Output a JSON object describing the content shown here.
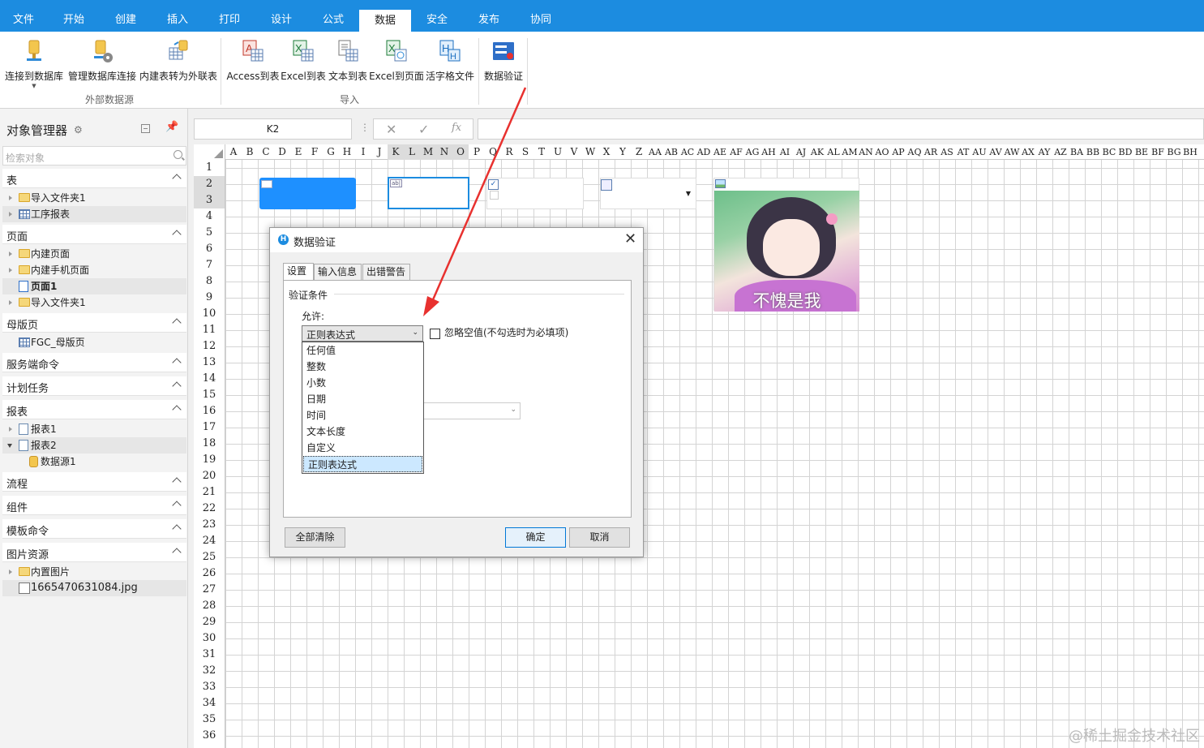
{
  "menu": {
    "tabs": [
      "文件",
      "开始",
      "创建",
      "插入",
      "打印",
      "设计",
      "公式",
      "数据",
      "安全",
      "发布",
      "协同"
    ],
    "active": "数据"
  },
  "ribbon": {
    "buttons": [
      "连接到数据库",
      "管理数据库连接",
      "内建表转为外联表",
      "Access到表",
      "Excel到表",
      "文本到表",
      "Excel到页面",
      "活字格文件",
      "数据验证"
    ],
    "groups": [
      "外部数据源",
      "导入"
    ]
  },
  "side": {
    "title": "对象管理器",
    "search_placeholder": "检索对象",
    "sections": [
      "表",
      "页面",
      "母版页",
      "服务端命令",
      "计划任务",
      "报表",
      "流程",
      "组件",
      "模板命令",
      "图片资源"
    ],
    "items": [
      "导入文件夹1",
      "工序报表",
      "内建页面",
      "内建手机页面",
      "页面1",
      "导入文件夹1",
      "FGC_母版页",
      "报表1",
      "报表2",
      "数据源1",
      "内置图片",
      "1665470631084.jpg"
    ]
  },
  "formula": {
    "cell": "K2",
    "dots": "⋮",
    "cancel": "✕",
    "confirm": "✓",
    "fx": "fx",
    "value": ""
  },
  "sheet": {
    "columns": [
      "A",
      "B",
      "C",
      "D",
      "E",
      "F",
      "G",
      "H",
      "I",
      "J",
      "K",
      "L",
      "M",
      "N",
      "O",
      "P",
      "Q",
      "R",
      "S",
      "T",
      "U",
      "V",
      "W",
      "X",
      "Y",
      "Z",
      "AA",
      "AB",
      "AC",
      "AD",
      "AE",
      "AF",
      "AG",
      "AH",
      "AI",
      "AJ",
      "AK",
      "AL",
      "AM",
      "AN",
      "AO",
      "AP",
      "AQ",
      "AR",
      "AS",
      "AT",
      "AU",
      "AV",
      "AW",
      "AX",
      "AY",
      "AZ",
      "BA",
      "BB",
      "BC",
      "BD",
      "BE",
      "BF",
      "BG",
      "BH"
    ],
    "rows": [
      "1",
      "2",
      "3",
      "4",
      "5",
      "6",
      "7",
      "8",
      "9",
      "10",
      "11",
      "12",
      "13",
      "14",
      "15",
      "16",
      "17",
      "18",
      "19",
      "20",
      "21",
      "22",
      "23",
      "24",
      "25",
      "26",
      "27",
      "28",
      "29",
      "30",
      "31",
      "32",
      "33",
      "34",
      "35",
      "36"
    ],
    "image_caption": "不愧是我"
  },
  "dialog": {
    "title": "数据验证",
    "tabs": [
      "设置",
      "输入信息",
      "出错警告"
    ],
    "legend": "验证条件",
    "allow_label": "允许:",
    "allow_value": "正则表达式",
    "ignore_blank": "忽略空值(不勾选时为必填项)",
    "options": [
      "任何值",
      "整数",
      "小数",
      "日期",
      "时间",
      "文本长度",
      "自定义",
      "正则表达式"
    ],
    "clear_all": "全部清除",
    "ok": "确定",
    "cancel": "取消"
  },
  "watermark": "@稀土掘金技术社区",
  "colors": {
    "accent": "#1c8ce0",
    "annotation": "#e8312f"
  }
}
